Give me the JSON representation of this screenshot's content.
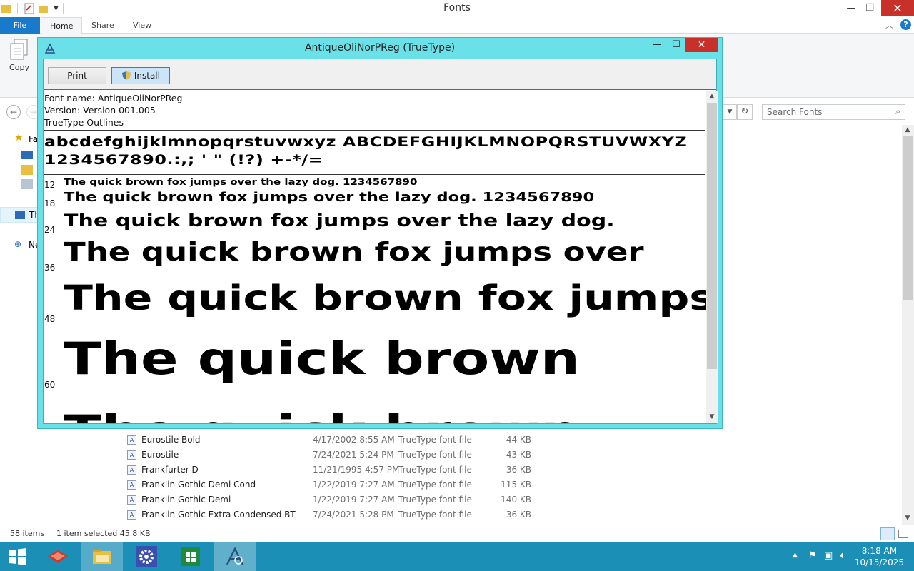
{
  "explorer": {
    "title": "Fonts",
    "tabs": [
      "File",
      "Home",
      "Share",
      "View"
    ],
    "ribbon_copy_label": "Copy",
    "search_placeholder": "Search Fonts",
    "nav_labels": [
      "Fa",
      "Th",
      "Ne"
    ],
    "files": [
      {
        "name": "Eurostile Bold",
        "date": "4/17/2002 8:55 AM",
        "type": "TrueType font file",
        "size": "44 KB"
      },
      {
        "name": "Eurostile",
        "date": "7/24/2021 5:24 PM",
        "type": "TrueType font file",
        "size": "43 KB"
      },
      {
        "name": "Frankfurter D",
        "date": "11/21/1995 4:57 PM",
        "type": "TrueType font file",
        "size": "36 KB"
      },
      {
        "name": "Franklin Gothic Demi Cond",
        "date": "1/22/2019 7:27 AM",
        "type": "TrueType font file",
        "size": "115 KB"
      },
      {
        "name": "Franklin Gothic Demi",
        "date": "1/22/2019 7:27 AM",
        "type": "TrueType font file",
        "size": "140 KB"
      },
      {
        "name": "Franklin Gothic Extra Condensed BT",
        "date": "7/24/2021 5:28 PM",
        "type": "TrueType font file",
        "size": "36 KB"
      }
    ],
    "status": {
      "items": "58 items",
      "selected": "1 item selected  45.8 KB"
    }
  },
  "viewer": {
    "title": "AntiqueOliNorPReg (TrueType)",
    "print_label": "Print",
    "install_label": "Install",
    "font_name": "Font name: AntiqueOliNorPReg",
    "version": "Version: Version 001.005",
    "outlines": "TrueType Outlines",
    "alphabet_line1": "abcdefghijklmnopqrstuvwxyz ABCDEFGHIJKLMNOPQRSTUVWXYZ",
    "alphabet_line2": "1234567890.:,; ' \" (!?) +-*/=",
    "samples": [
      {
        "size": "12",
        "text": "The quick brown fox jumps over the lazy dog. 1234567890"
      },
      {
        "size": "18",
        "text": "The quick brown fox jumps over the lazy dog. 1234567890"
      },
      {
        "size": "24",
        "text": "The quick brown fox jumps over the lazy dog."
      },
      {
        "size": "36",
        "text": "The quick brown fox jumps over"
      },
      {
        "size": "48",
        "text": "The quick brown fox jumps"
      },
      {
        "size": "60",
        "text": "The quick brown"
      }
    ]
  },
  "taskbar": {
    "time": "8:18 AM",
    "date": "10/15/2025"
  },
  "colors": {
    "taskbar": "#1c8fb7",
    "viewer_frame": "#6ae0e8",
    "close_button": "#c7312a",
    "file_tab": "#1979ca"
  }
}
